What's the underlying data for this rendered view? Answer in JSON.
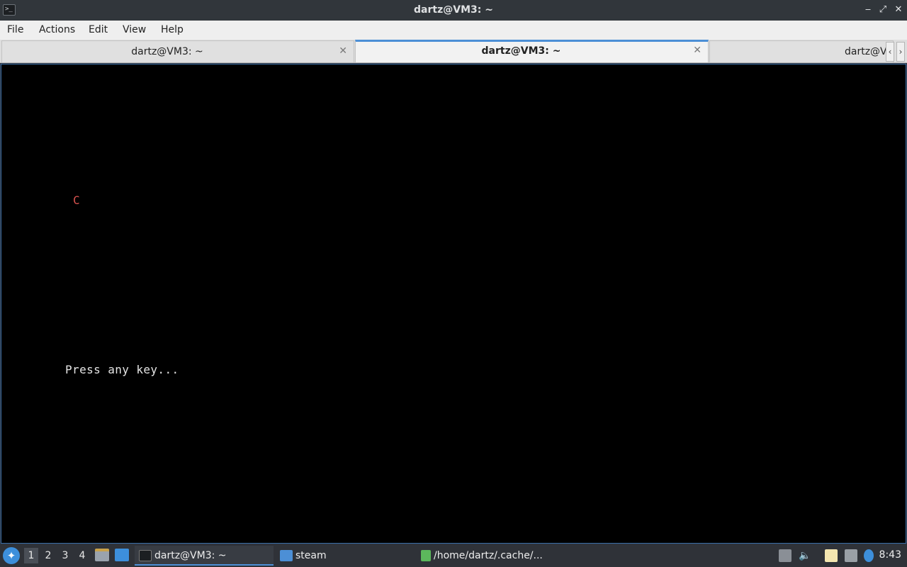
{
  "window": {
    "title": "dartz@VM3: ~",
    "app_icon_text": ">_",
    "minimize_glyph": "‒",
    "maximize_glyph": "⤢",
    "close_glyph": "✕"
  },
  "menubar": {
    "items": [
      "File",
      "Actions",
      "Edit",
      "View",
      "Help"
    ]
  },
  "tabs": {
    "items": [
      {
        "label": "dartz@VM3: ~",
        "active": false
      },
      {
        "label": "dartz@VM3: ~",
        "active": true
      },
      {
        "label": "dartz@V",
        "active": false
      }
    ],
    "close_glyph": "✕",
    "scroll_left_glyph": "‹",
    "scroll_right_glyph": "›"
  },
  "terminal": {
    "glyph_c": "C",
    "prompt_text": "Press any key..."
  },
  "taskbar": {
    "start_icon": "start-menu-icon",
    "workspaces": [
      "1",
      "2",
      "3",
      "4"
    ],
    "active_workspace": "1",
    "tasks": [
      {
        "label": "dartz@VM3: ~",
        "icon": "terminal-icon",
        "active": true
      },
      {
        "label": "steam",
        "icon": "folder-icon",
        "active": false
      },
      {
        "label": "/home/dartz/.cache/...",
        "icon": "archive-icon",
        "active": false
      }
    ],
    "clock": "8:43"
  },
  "colors": {
    "accent": "#4c8fd6",
    "terminal_bg": "#000000",
    "terminal_fg": "#e5e5e5",
    "glyph_red": "#d9534f",
    "titlebar_bg": "#31363b",
    "taskbar_bg": "#2f3238"
  }
}
